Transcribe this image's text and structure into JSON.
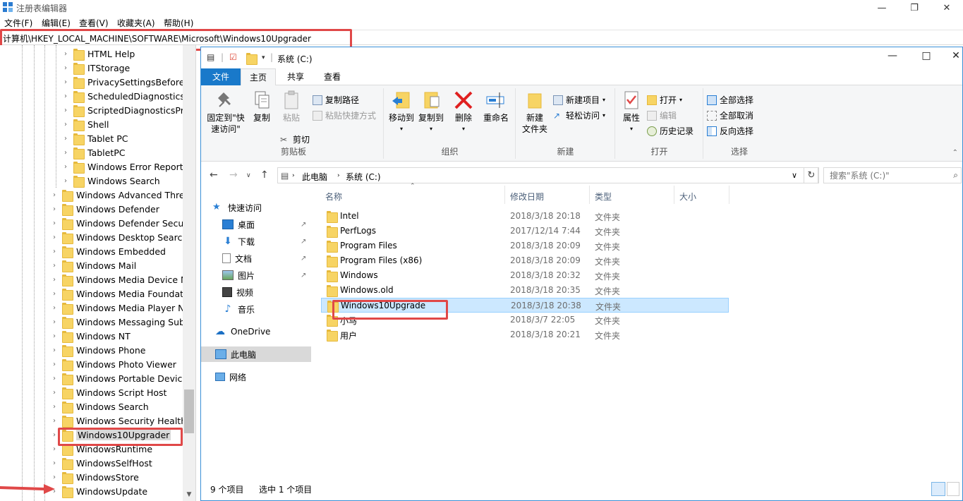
{
  "registry": {
    "title": "注册表编辑器",
    "menus": [
      "文件(F)",
      "编辑(E)",
      "查看(V)",
      "收藏夹(A)",
      "帮助(H)"
    ],
    "address": "计算机\\HKEY_LOCAL_MACHINE\\SOFTWARE\\Microsoft\\Windows10Upgrader",
    "tree": [
      {
        "label": "HTML Help",
        "level": 2
      },
      {
        "label": "ITStorage",
        "level": 2
      },
      {
        "label": "PrivacySettingsBeforeCr",
        "level": 2
      },
      {
        "label": "ScheduledDiagnostics",
        "level": 2
      },
      {
        "label": "ScriptedDiagnosticsProv",
        "level": 2
      },
      {
        "label": "Shell",
        "level": 2
      },
      {
        "label": "Tablet PC",
        "level": 2
      },
      {
        "label": "TabletPC",
        "level": 2
      },
      {
        "label": "Windows Error Reportin",
        "level": 2
      },
      {
        "label": "Windows Search",
        "level": 2
      },
      {
        "label": "Windows Advanced Threat",
        "level": 1
      },
      {
        "label": "Windows Defender",
        "level": 1
      },
      {
        "label": "Windows Defender Securit",
        "level": 1
      },
      {
        "label": "Windows Desktop Search",
        "level": 1
      },
      {
        "label": "Windows Embedded",
        "level": 1
      },
      {
        "label": "Windows Mail",
        "level": 1
      },
      {
        "label": "Windows Media Device M",
        "level": 1
      },
      {
        "label": "Windows Media Foundatic",
        "level": 1
      },
      {
        "label": "Windows Media Player NS",
        "level": 1
      },
      {
        "label": "Windows Messaging Subs",
        "level": 1
      },
      {
        "label": "Windows NT",
        "level": 1
      },
      {
        "label": "Windows Phone",
        "level": 1
      },
      {
        "label": "Windows Photo Viewer",
        "level": 1
      },
      {
        "label": "Windows Portable Devices",
        "level": 1
      },
      {
        "label": "Windows Script Host",
        "level": 1
      },
      {
        "label": "Windows Search",
        "level": 1
      },
      {
        "label": "Windows Security Health",
        "level": 1
      },
      {
        "label": "Windows10Upgrader",
        "level": 1,
        "selected": true
      },
      {
        "label": "WindowsRuntime",
        "level": 1
      },
      {
        "label": "WindowsSelfHost",
        "level": 1
      },
      {
        "label": "WindowsStore",
        "level": 1
      },
      {
        "label": "WindowsUpdate",
        "level": 1
      }
    ]
  },
  "explorer": {
    "title": "系统 (C:)",
    "tabs": {
      "file": "文件",
      "home": "主页",
      "share": "共享",
      "view": "查看"
    },
    "ribbon": {
      "pin_label_1": "固定到\"快",
      "pin_label_2": "速访问\"",
      "copy": "复制",
      "paste": "粘贴",
      "copy_path": "复制路径",
      "paste_shortcut": "粘贴快捷方式",
      "cut": "剪切",
      "clipboard": "剪贴板",
      "move_to": "移动到",
      "copy_to": "复制到",
      "delete": "删除",
      "rename": "重命名",
      "organize": "组织",
      "new_folder_1": "新建",
      "new_folder_2": "文件夹",
      "new_item": "新建项目",
      "easy_access": "轻松访问",
      "new": "新建",
      "properties": "属性",
      "open": "打开",
      "edit": "编辑",
      "history": "历史记录",
      "open_group": "打开",
      "select_all": "全部选择",
      "select_none": "全部取消",
      "invert": "反向选择",
      "select_group": "选择"
    },
    "breadcrumb": [
      "此电脑",
      "系统 (C:)"
    ],
    "search_placeholder": "搜索\"系统 (C:)\"",
    "nav": {
      "quick_access": "快速访问",
      "desktop": "桌面",
      "downloads": "下载",
      "documents": "文档",
      "pictures": "图片",
      "videos": "视频",
      "music": "音乐",
      "onedrive": "OneDrive",
      "this_pc": "此电脑",
      "network": "网络"
    },
    "columns": {
      "name": "名称",
      "date": "修改日期",
      "type": "类型",
      "size": "大小"
    },
    "files": [
      {
        "name": "Intel",
        "date": "2018/3/18 20:18",
        "type": "文件夹"
      },
      {
        "name": "PerfLogs",
        "date": "2017/12/14 7:44",
        "type": "文件夹"
      },
      {
        "name": "Program Files",
        "date": "2018/3/18 20:09",
        "type": "文件夹"
      },
      {
        "name": "Program Files (x86)",
        "date": "2018/3/18 20:09",
        "type": "文件夹"
      },
      {
        "name": "Windows",
        "date": "2018/3/18 20:32",
        "type": "文件夹"
      },
      {
        "name": "Windows.old",
        "date": "2018/3/18 20:35",
        "type": "文件夹"
      },
      {
        "name": "Windows10Upgrade",
        "date": "2018/3/18 20:38",
        "type": "文件夹",
        "selected": true
      },
      {
        "name": "小马",
        "date": "2018/3/7 22:05",
        "type": "文件夹"
      },
      {
        "name": "用户",
        "date": "2018/3/18 20:21",
        "type": "文件夹"
      }
    ],
    "status": {
      "count": "9 个项目",
      "selected": "选中 1 个项目"
    }
  },
  "colors": {
    "accent": "#1979ca",
    "highlight": "#e04848",
    "selection": "#cce8ff",
    "folder": "#f7d464"
  }
}
